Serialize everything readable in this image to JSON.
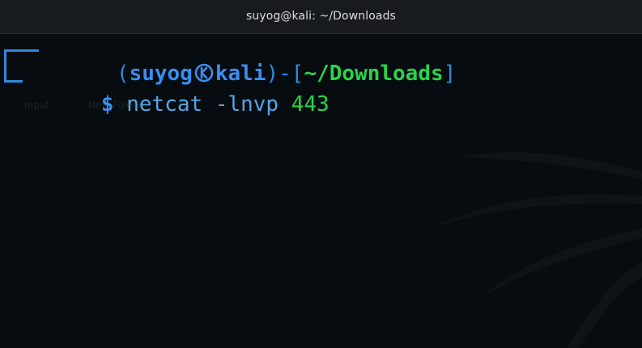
{
  "window": {
    "title": "suyog@kali: ~/Downloads"
  },
  "prompt": {
    "open_paren": "(",
    "user": "suyog",
    "separator_icon": "kali-logo-icon",
    "host": "kali",
    "close_paren": ")",
    "dash": "-",
    "open_bracket": "[",
    "path": "~/Downloads",
    "close_bracket": "]",
    "symbol": "$"
  },
  "command": {
    "program": "netcat",
    "flags": "-lnvp",
    "port": "443"
  },
  "desktop_ghost_labels": [
    "Input",
    "New Folder"
  ],
  "colors": {
    "background": "#060c0f",
    "prompt_blue": "#3b8ef0",
    "path_green": "#29d34a",
    "command_cyan": "#52a8e6"
  }
}
